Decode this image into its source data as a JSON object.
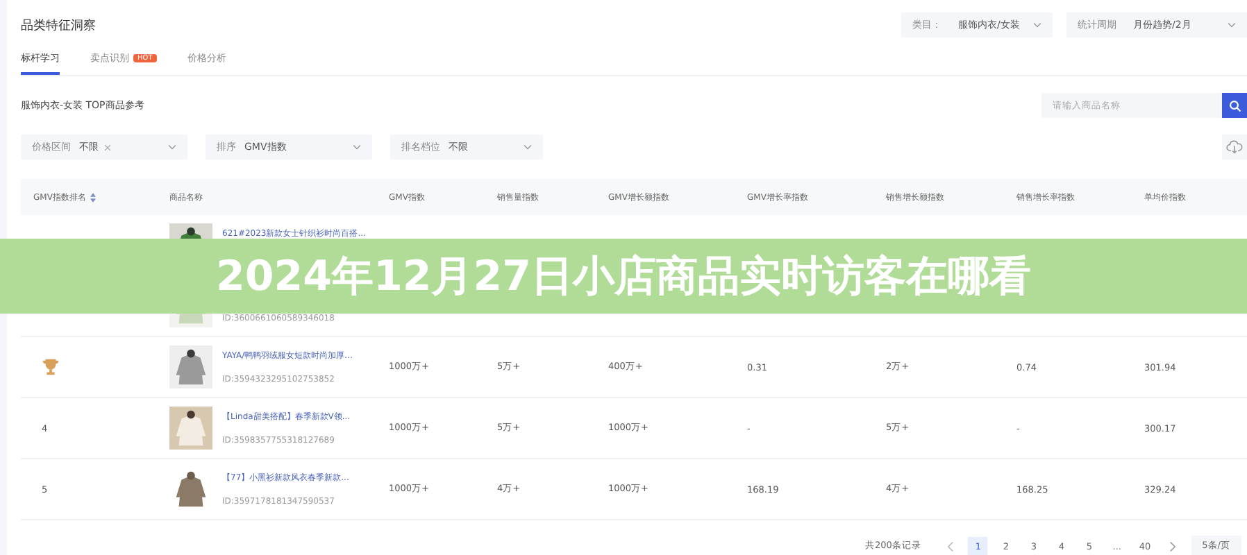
{
  "header": {
    "title": "品类特征洞察",
    "selects": [
      {
        "label": "类目：",
        "value": "服饰内衣/女装"
      },
      {
        "label": "统计周期",
        "value": "月份趋势/2月"
      }
    ]
  },
  "tabs": [
    {
      "label": "标杆学习",
      "selected": true
    },
    {
      "label": "卖点识别",
      "badge": "HOT",
      "selected": false
    },
    {
      "label": "价格分析",
      "selected": false
    }
  ],
  "subtitle": "服饰内衣-女装 TOP商品参考",
  "search": {
    "placeholder": "请输入商品名称"
  },
  "filters": [
    {
      "label": "价格区间",
      "value": "不限",
      "clearable": true
    },
    {
      "label": "排序",
      "value": "GMV指数",
      "clearable": false
    },
    {
      "label": "排名档位",
      "value": "不限",
      "clearable": false
    }
  ],
  "table": {
    "columns": [
      "GMV指数排名",
      "商品名称",
      "GMV指数",
      "销售量指数",
      "GMV增长额指数",
      "GMV增长率指数",
      "销售增长额指数",
      "销售增长率指数",
      "单均价指数"
    ],
    "rows": [
      {
        "name": "621#2023新款女士针织衫时尚百搭..."
      },
      {
        "id": "ID:3600661060589346018"
      },
      {
        "rank": {
          "kind": "trophy",
          "color": "#d9a05b"
        },
        "name": "YAYA/鸭鸭羽绒服女短款时尚加厚...",
        "id": "ID:3594323295102753852",
        "values": [
          "1000万+",
          "5万+",
          "400万+",
          "0.31",
          "2万+",
          "0.74",
          "301.94"
        ]
      },
      {
        "rank": {
          "kind": "number",
          "label": "4"
        },
        "name": "【Linda甜美搭配】春季新款V领...",
        "id": "ID:3598357755318127689",
        "values": [
          "1000万+",
          "5万+",
          "1000万+",
          "-",
          "5万+",
          "-",
          "300.17"
        ]
      },
      {
        "rank": {
          "kind": "number",
          "label": "5"
        },
        "name": "【77】小黑衫新款风衣春季新款...",
        "id": "ID:3597178181347590537",
        "values": [
          "1000万+",
          "4万+",
          "1000万+",
          "168.19",
          "4万+",
          "168.25",
          "329.24"
        ]
      }
    ]
  },
  "pagination": {
    "total": "共200条记录",
    "pages": [
      {
        "label": "1",
        "selected": true
      },
      {
        "label": "2",
        "selected": false
      },
      {
        "label": "3",
        "selected": false
      },
      {
        "label": "4",
        "selected": false
      },
      {
        "label": "5",
        "selected": false
      },
      {
        "label": "...",
        "selected": false
      },
      {
        "label": "40",
        "selected": false
      }
    ],
    "page_size": "5条/页"
  },
  "banner": {
    "title": "2024年12月27日小店商品实时访客在哪看"
  }
}
